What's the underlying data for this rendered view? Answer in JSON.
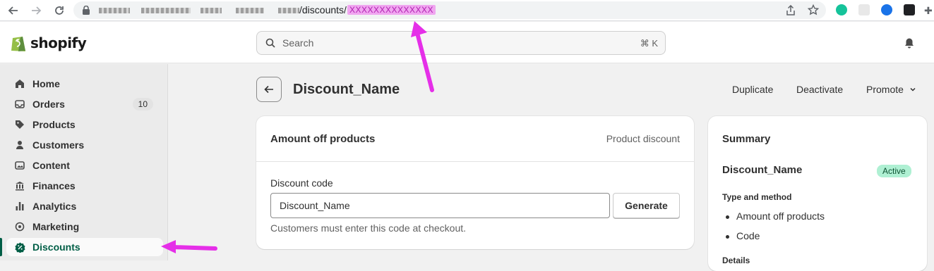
{
  "browser": {
    "url_path": "/discounts/",
    "url_id": "XXXXXXXXXXXXXX"
  },
  "brand": {
    "name": "shopify"
  },
  "search": {
    "placeholder": "Search",
    "shortcut": "⌘ K"
  },
  "sidebar": {
    "items": [
      {
        "label": "Home",
        "icon": "home-icon"
      },
      {
        "label": "Orders",
        "icon": "orders-icon",
        "badge": "10"
      },
      {
        "label": "Products",
        "icon": "tag-icon"
      },
      {
        "label": "Customers",
        "icon": "person-icon"
      },
      {
        "label": "Content",
        "icon": "content-icon"
      },
      {
        "label": "Finances",
        "icon": "bank-icon"
      },
      {
        "label": "Analytics",
        "icon": "bar-chart-icon"
      },
      {
        "label": "Marketing",
        "icon": "target-icon"
      },
      {
        "label": "Discounts",
        "icon": "discount-icon",
        "active": true
      }
    ]
  },
  "header": {
    "title": "Discount_Name",
    "actions": {
      "duplicate": "Duplicate",
      "deactivate": "Deactivate",
      "promote": "Promote"
    }
  },
  "main_card": {
    "title": "Amount off products",
    "type": "Product discount",
    "code_label": "Discount code",
    "code_value": "Discount_Name",
    "generate_label": "Generate",
    "helper": "Customers must enter this code at checkout."
  },
  "summary": {
    "title": "Summary",
    "discount_name": "Discount_Name",
    "status": "Active",
    "type_heading": "Type and method",
    "bullets": [
      "Amount off products",
      "Code"
    ],
    "details_partial": "Details"
  },
  "colors": {
    "active_nav": "#005e46",
    "annotation_arrow": "#e52fe8",
    "status_bg": "#aff0d3"
  }
}
